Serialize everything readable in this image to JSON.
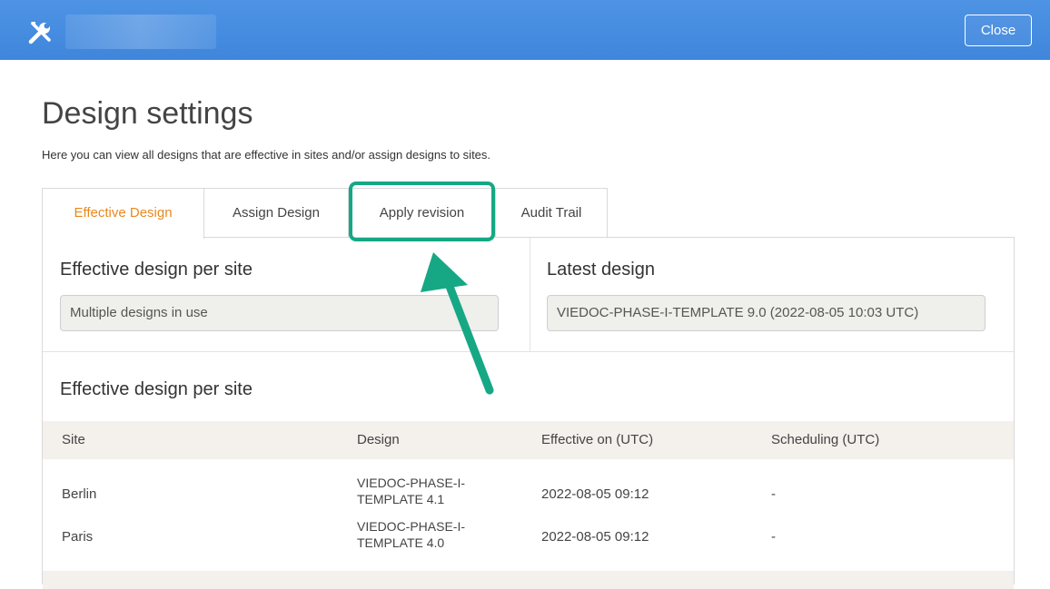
{
  "header": {
    "close_label": "Close",
    "icon": "tools-icon",
    "brand_color": "#4a90e2"
  },
  "page": {
    "title": "Design settings",
    "description": "Here you can view all designs that are effective in sites and/or assign designs to sites."
  },
  "tabs": [
    {
      "label": "Effective Design",
      "active": true
    },
    {
      "label": "Assign Design",
      "active": false
    },
    {
      "label": "Apply revision",
      "active": false,
      "highlighted": true
    },
    {
      "label": "Audit Trail",
      "active": false
    }
  ],
  "effective_panel": {
    "label": "Effective design per site",
    "value": "Multiple designs in use"
  },
  "latest_panel": {
    "label": "Latest design",
    "value": "VIEDOC-PHASE-I-TEMPLATE 9.0 (2022-08-05 10:03 UTC)"
  },
  "table": {
    "title": "Effective design per site",
    "columns": [
      "Site",
      "Design",
      "Effective on (UTC)",
      "Scheduling (UTC)"
    ],
    "rows": [
      {
        "site": "Berlin",
        "design_line1": "VIEDOC-PHASE-I-",
        "design_line2": "TEMPLATE 4.1",
        "effective_on": "2022-08-05 09:12",
        "scheduling": "-"
      },
      {
        "site": "Paris",
        "design_line1": "VIEDOC-PHASE-I-",
        "design_line2": "TEMPLATE 4.0",
        "effective_on": "2022-08-05 09:12",
        "scheduling": "-"
      }
    ]
  },
  "colors": {
    "active_tab": "#e8891d",
    "highlight": "#16a884",
    "table_header_bg": "#f4f0ec"
  }
}
